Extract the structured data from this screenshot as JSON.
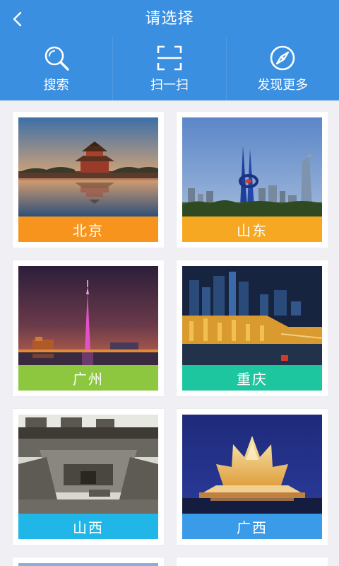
{
  "header": {
    "title": "请选择",
    "background": "#3a8fe0"
  },
  "actions": [
    {
      "label": "搜索",
      "icon": "search-icon"
    },
    {
      "label": "扫一扫",
      "icon": "scan-icon"
    },
    {
      "label": "发现更多",
      "icon": "compass-icon"
    }
  ],
  "cities": [
    {
      "name": "北京",
      "color": "#f7941d",
      "photo": "forbidden-city-corner-tower"
    },
    {
      "name": "山东",
      "color": "#f7a823",
      "photo": "jinan-spring-sculpture-skyline"
    },
    {
      "name": "广州",
      "color": "#8dc63f",
      "photo": "canton-tower-night"
    },
    {
      "name": "重庆",
      "color": "#1ec6a0",
      "photo": "chongqing-hongyadong-night"
    },
    {
      "name": "山西",
      "color": "#20b6e8",
      "photo": "shanxi-courtyard-houses"
    },
    {
      "name": "广西",
      "color": "#3a9be8",
      "photo": "nanning-stadium-night"
    }
  ]
}
